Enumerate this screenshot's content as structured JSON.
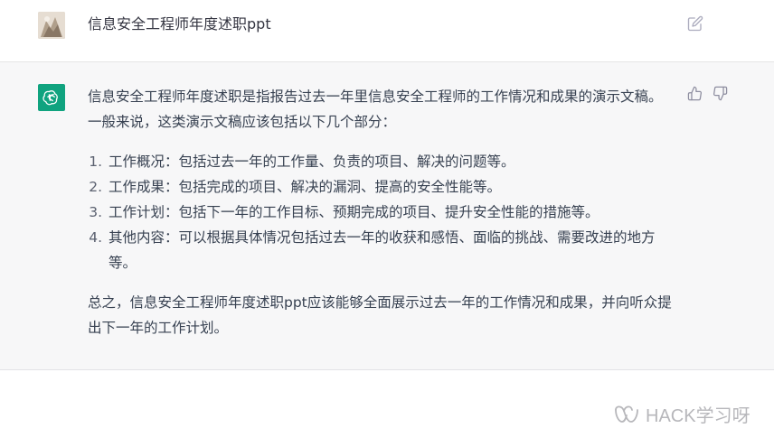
{
  "user": {
    "avatar_icon": "user-avatar-image",
    "message": "信息安全工程师年度述职ppt",
    "edit_icon": "edit-icon"
  },
  "assistant": {
    "avatar_icon": "openai-logo-icon",
    "brand_color": "#10a37f",
    "intro": "信息安全工程师年度述职是指报告过去一年里信息安全工程师的工作情况和成果的演示文稿。一般来说，这类演示文稿应该包括以下几个部分：",
    "items": [
      "工作概况：包括过去一年的工作量、负责的项目、解决的问题等。",
      "工作成果：包括完成的项目、解决的漏洞、提高的安全性能等。",
      "工作计划：包括下一年的工作目标、预期完成的项目、提升安全性能的措施等。",
      "其他内容：可以根据具体情况包括过去一年的收获和感悟、面临的挑战、需要改进的地方等。"
    ],
    "conclusion": "总之，信息安全工程师年度述职ppt应该能够全面展示过去一年的工作情况和成果，并向听众提出下一年的工作计划。"
  },
  "watermark": {
    "text": "HACK学习呀",
    "icon": "wechat-channel-icon"
  }
}
